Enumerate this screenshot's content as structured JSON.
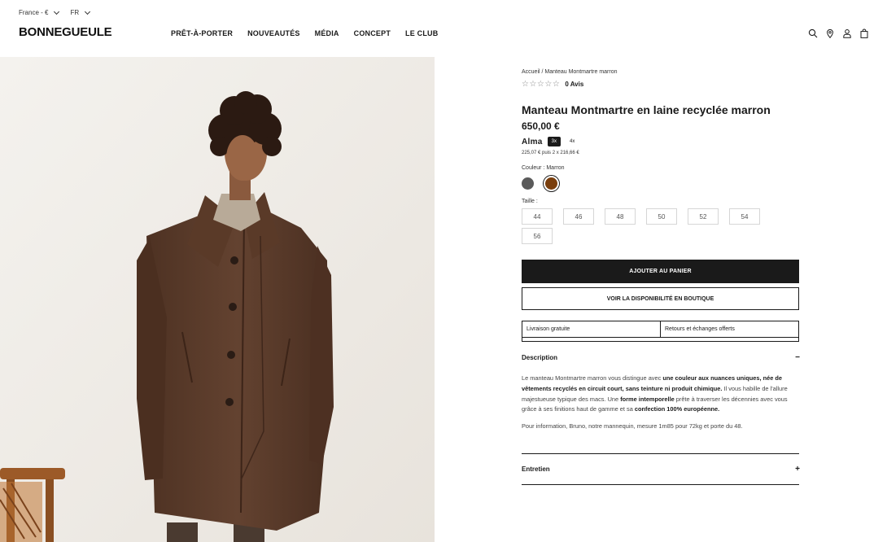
{
  "topbar": {
    "country": "France - €",
    "language": "FR"
  },
  "brand": {
    "logo": "BONNEGUEULE"
  },
  "nav": {
    "items": [
      "PRÊT-À-PORTER",
      "NOUVEAUTÉS",
      "MÉDIA",
      "CONCEPT",
      "LE CLUB"
    ]
  },
  "header_icons": [
    "search-icon",
    "location-pin-icon",
    "user-icon",
    "shopping-bag-icon"
  ],
  "product": {
    "breadcrumb": "Accueil / Manteau Montmartre marron",
    "rating_stars": "☆☆☆☆☆",
    "review_count": "0 Avis",
    "title": "Manteau Montmartre en laine recyclée marron",
    "price": "650,00 €",
    "alma": {
      "brand": "Alma",
      "options": [
        "3x",
        "4x"
      ],
      "selected": "3x",
      "detail": "225,07 € puis 2 x 216,66 €"
    },
    "color_label": "Couleur :  Marron",
    "colors": [
      {
        "name": "gris",
        "hex": "#5a5a5a",
        "selected": false
      },
      {
        "name": "marron",
        "hex": "#7a3e0c",
        "selected": true
      }
    ],
    "size_label": "Taille :",
    "sizes": [
      "44",
      "46",
      "48",
      "50",
      "52",
      "54",
      "56"
    ],
    "add_to_cart": "AJOUTER AU PANIER",
    "store_availability": "VOIR LA DISPONIBILITÉ EN BOUTIQUE",
    "perks": [
      "Livraison gratuite",
      "Retours et échanges offerts"
    ],
    "description": {
      "heading": "Description",
      "toggle": "−",
      "p1": [
        {
          "text": "Le manteau Montmartre marron vous distingue avec ",
          "bold": false
        },
        {
          "text": "une couleur aux nuances uniques, née de vêtements recyclés en circuit court, sans teinture ni produit chimique.",
          "bold": true
        },
        {
          "text": " Il vous habille de l'allure majestueuse typique des macs. Une ",
          "bold": false
        },
        {
          "text": "forme intemporelle",
          "bold": true
        },
        {
          "text": " prête à traverser les décennies avec vous grâce à ses finitions haut de gamme et sa ",
          "bold": false
        },
        {
          "text": "confection 100% européenne.",
          "bold": true
        }
      ],
      "p2": "Pour information, Bruno, notre mannequin, mesure 1m85 pour 72kg et porte du 48."
    },
    "care": {
      "heading": "Entretien",
      "toggle": "+"
    }
  },
  "colors": {
    "text": "#1a1a1a",
    "button_bg": "#1a1a1a",
    "photo_bg": "#efece7",
    "coat": "#5e3d2a"
  }
}
